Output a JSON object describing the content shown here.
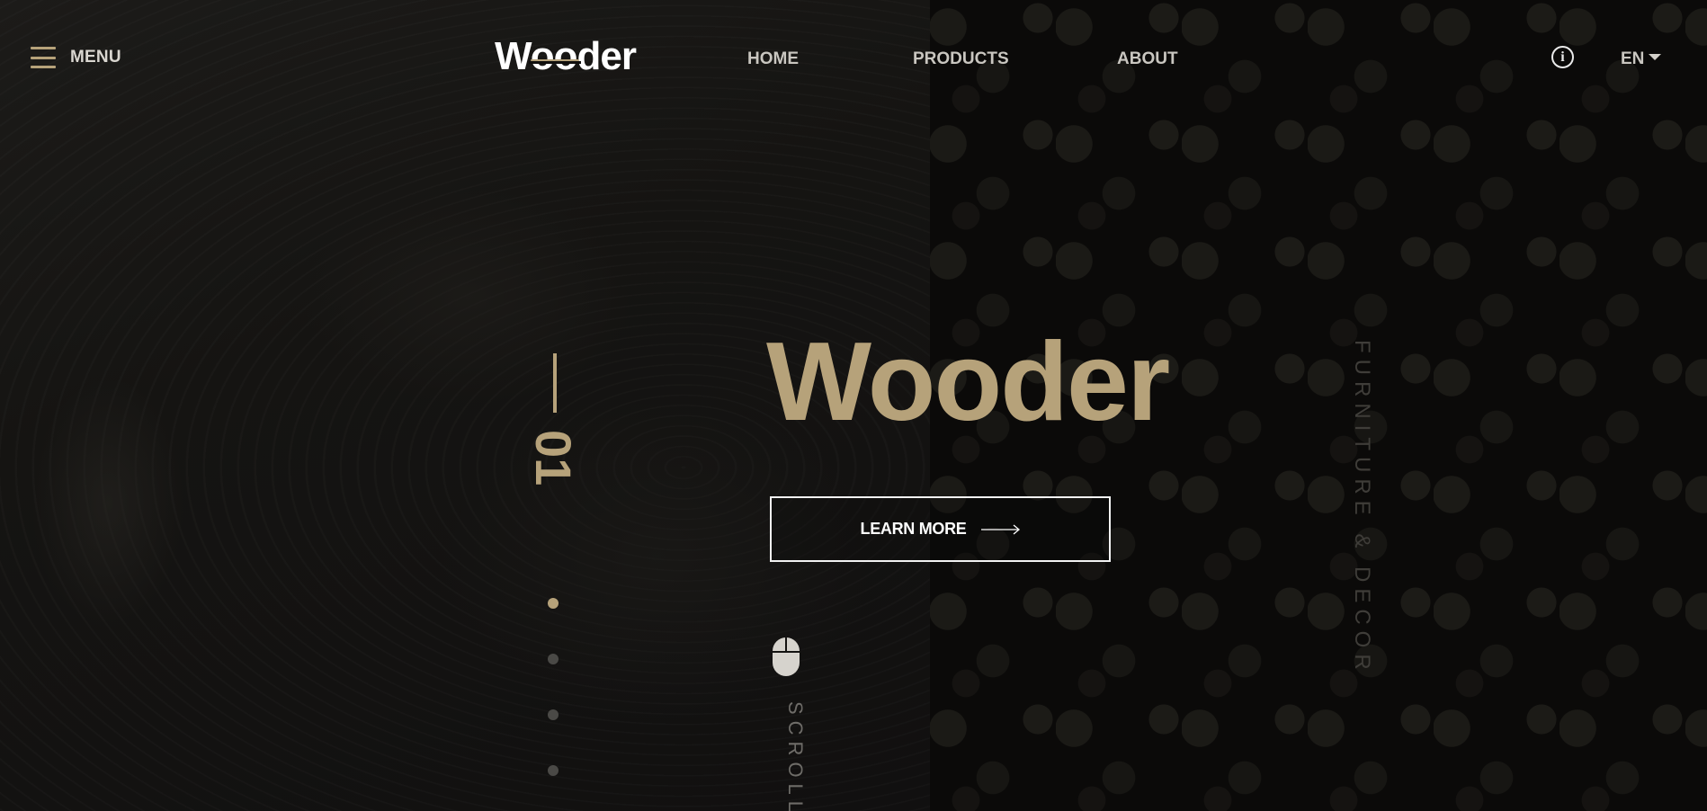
{
  "header": {
    "menu_label": "MENU",
    "logo": "Wooder",
    "nav": [
      {
        "label": "HOME"
      },
      {
        "label": "PRODUCTS"
      },
      {
        "label": "ABOUT"
      }
    ],
    "info_icon_glyph": "i",
    "language": "EN"
  },
  "slider": {
    "current_number": "01",
    "dots_total": 4,
    "active_dot": 1
  },
  "hero": {
    "title": "Wooder",
    "cta_label": "LEARN MORE",
    "scroll_label": "SCROLL",
    "tagline": "FURNITURE & DECOR"
  },
  "icons": {
    "menu": "hamburger-icon",
    "info": "info-icon",
    "language_caret": "caret-down-icon",
    "cta_arrow": "arrow-right-icon",
    "scroll": "mouse-icon"
  },
  "colors": {
    "accent_gold": "#b6a27a",
    "text_light": "#c9c6c0",
    "dot_inactive": "#4a4946",
    "tagline": "#3f3d39"
  }
}
